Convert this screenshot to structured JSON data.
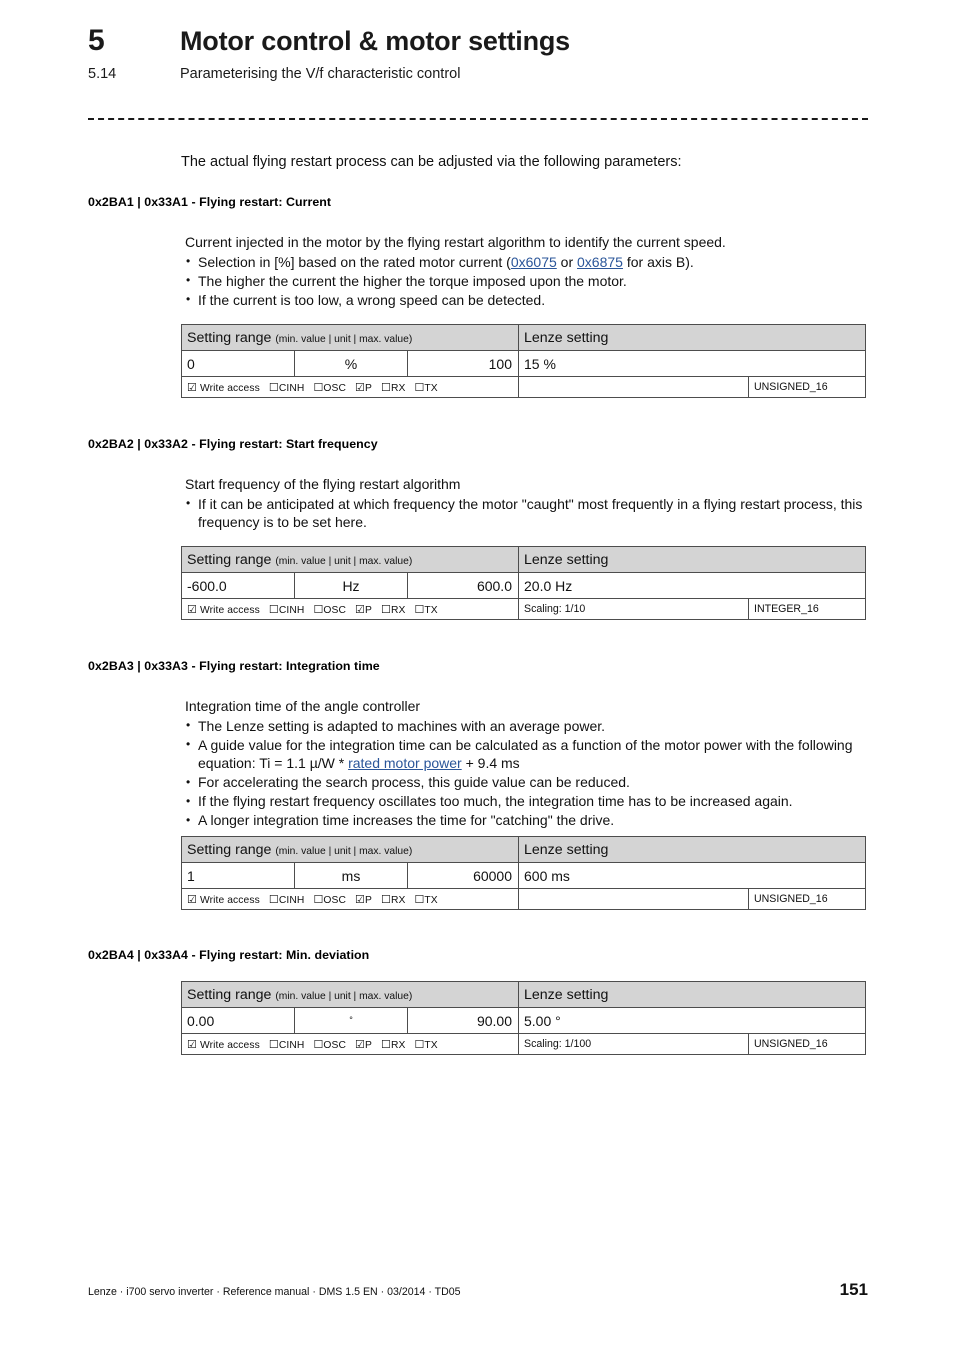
{
  "header": {
    "chapter_number": "5",
    "chapter_title": "Motor control & motor settings",
    "section_number": "5.14",
    "section_title": "Parameterising the V/f characteristic control"
  },
  "intro": "The actual flying restart process can be adjusted via the following parameters:",
  "table_headers": {
    "setting_range": "Setting range",
    "setting_range_sub": "(min. value | unit | max. value)",
    "lenze_setting": "Lenze setting"
  },
  "access_row": {
    "checked_glyph": "☑",
    "unchecked_glyph": "☐",
    "write_access": "Write access",
    "cinh": "CINH",
    "osc": "OSC",
    "p": "P",
    "rx": "RX",
    "tx": "TX"
  },
  "parameters": [
    {
      "title": "0x2BA1 | 0x33A1 - Flying restart: Current",
      "lead": "Current injected in the motor by the flying restart algorithm to identify the current speed.",
      "bullets": [
        {
          "parts": [
            {
              "type": "text",
              "text": "Selection in [%] based on the rated motor current ("
            },
            {
              "type": "link",
              "text": "0x6075"
            },
            {
              "type": "text",
              "text": " or "
            },
            {
              "type": "link",
              "text": "0x6875"
            },
            {
              "type": "text",
              "text": " for axis B)."
            }
          ]
        },
        {
          "parts": [
            {
              "type": "text",
              "text": "The higher the current the higher the torque imposed upon the motor."
            }
          ]
        },
        {
          "parts": [
            {
              "type": "text",
              "text": "If the current is too low, a wrong speed can be detected."
            }
          ]
        }
      ],
      "table": {
        "min": "0",
        "unit": "%",
        "max": "100",
        "lenze": "15 %",
        "scaling": "",
        "data_type": "UNSIGNED_16"
      }
    },
    {
      "title": "0x2BA2 | 0x33A2 - Flying restart: Start frequency",
      "lead": "Start frequency of the flying restart algorithm",
      "bullets": [
        {
          "parts": [
            {
              "type": "text",
              "text": "If it can be anticipated at which frequency the motor \"caught\" most frequently in a flying restart process, this frequency is to be set here."
            }
          ]
        }
      ],
      "table": {
        "min": "-600.0",
        "unit": "Hz",
        "max": "600.0",
        "lenze": "20.0 Hz",
        "scaling": "Scaling: 1/10",
        "data_type": "INTEGER_16"
      }
    },
    {
      "title": "0x2BA3 | 0x33A3 - Flying restart: Integration time",
      "lead": "Integration time of the angle controller",
      "bullets": [
        {
          "parts": [
            {
              "type": "text",
              "text": "The Lenze setting is adapted to machines with an average power."
            }
          ]
        },
        {
          "parts": [
            {
              "type": "text",
              "text": "A guide value for the integration time can be calculated as a function of the motor power with the following equation: Ti = 1.1 µ/W * "
            },
            {
              "type": "link",
              "text": "rated motor power"
            },
            {
              "type": "text",
              "text": " + 9.4 ms"
            }
          ]
        },
        {
          "parts": [
            {
              "type": "text",
              "text": "For accelerating the search process, this guide value can be reduced."
            }
          ]
        },
        {
          "parts": [
            {
              "type": "text",
              "text": "If the flying restart frequency oscillates too much, the integration time has to be increased again."
            }
          ]
        },
        {
          "parts": [
            {
              "type": "text",
              "text": "A longer integration time increases the time for \"catching\" the drive."
            }
          ]
        }
      ],
      "table": {
        "min": "1",
        "unit": "ms",
        "max": "60000",
        "lenze": "600 ms",
        "scaling": "",
        "data_type": "UNSIGNED_16"
      }
    },
    {
      "title": "0x2BA4 | 0x33A4 - Flying restart: Min. deviation",
      "lead": "",
      "bullets": [],
      "table": {
        "min": "0.00",
        "unit": "°",
        "unit_is_degree": true,
        "max": "90.00",
        "lenze": "5.00 °",
        "scaling": "Scaling: 1/100",
        "data_type": "UNSIGNED_16"
      }
    }
  ],
  "footer": {
    "text": "Lenze · i700 servo inverter · Reference manual · DMS 1.5 EN · 03/2014 · TD05",
    "page_number": "151"
  },
  "colors": {
    "link": "#2a5599",
    "table_header_bg": "#d4d4d4",
    "text": "#111111"
  }
}
